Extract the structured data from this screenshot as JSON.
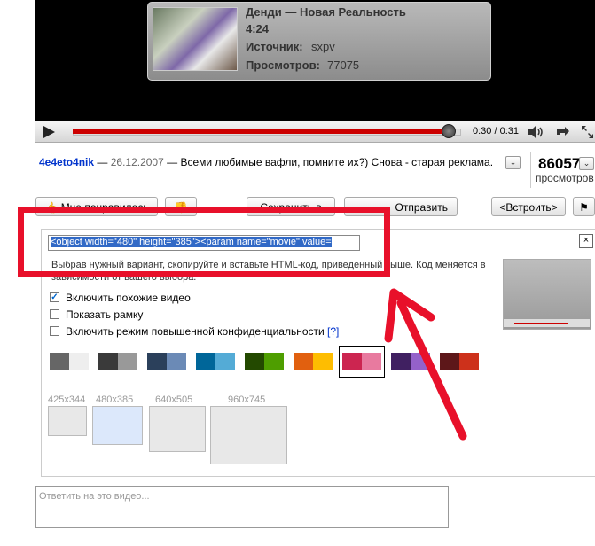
{
  "video": {
    "title": "Денди — Новая Реальность",
    "duration": "4:24",
    "source_label": "Источник:",
    "source_value": "sxpv",
    "views_label": "Просмотров:",
    "views_value": "77075",
    "time": "0:30 / 0:31",
    "progress": 0.97
  },
  "info": {
    "author": "4e4eto4nik",
    "date": "26.12.2007",
    "sep1": " — ",
    "sep2": " — ",
    "description": "Всеми любимые вафли, помните их?) Снова - старая реклама.",
    "view_count": "86057",
    "view_count_label": "просмотров"
  },
  "actions": {
    "like": "Мне понравилось",
    "save": "Сохранить в",
    "send": "Отправить",
    "embed": "<Встроить>"
  },
  "embed": {
    "code": "<object width=\"480\" height=\"385\"><param name=\"movie\" value=",
    "hint": "Выбрав нужный вариант, скопируйте и вставьте HTML-код, приведенный выше. Код меняется в зависимости от вашего выбора.",
    "close": "×",
    "options": [
      {
        "label": "Включить похожие видео",
        "checked": true
      },
      {
        "label": "Показать рамку",
        "checked": false
      },
      {
        "label": "Включить режим повышенной конфиденциальности",
        "checked": false
      }
    ],
    "privacy_link": "[?]",
    "sizes": [
      "425x344",
      "480x385",
      "640x505",
      "960x745"
    ],
    "selected_size": "480x385",
    "colors": [
      [
        "#666666",
        "#eeeeee"
      ],
      [
        "#3a3a3a",
        "#999999"
      ],
      [
        "#2b405b",
        "#6b8ab6"
      ],
      [
        "#006699",
        "#54abd6"
      ],
      [
        "#234900",
        "#4e9e00"
      ],
      [
        "#e1600f",
        "#febd01"
      ],
      [
        "#cc2550",
        "#e87a9f"
      ],
      [
        "#402061",
        "#9461ca"
      ],
      [
        "#5d1719",
        "#cd311b"
      ]
    ],
    "selected_color_index": 6
  },
  "reply_placeholder": "Ответить на это видео...",
  "annotation_color": "#e8102a"
}
